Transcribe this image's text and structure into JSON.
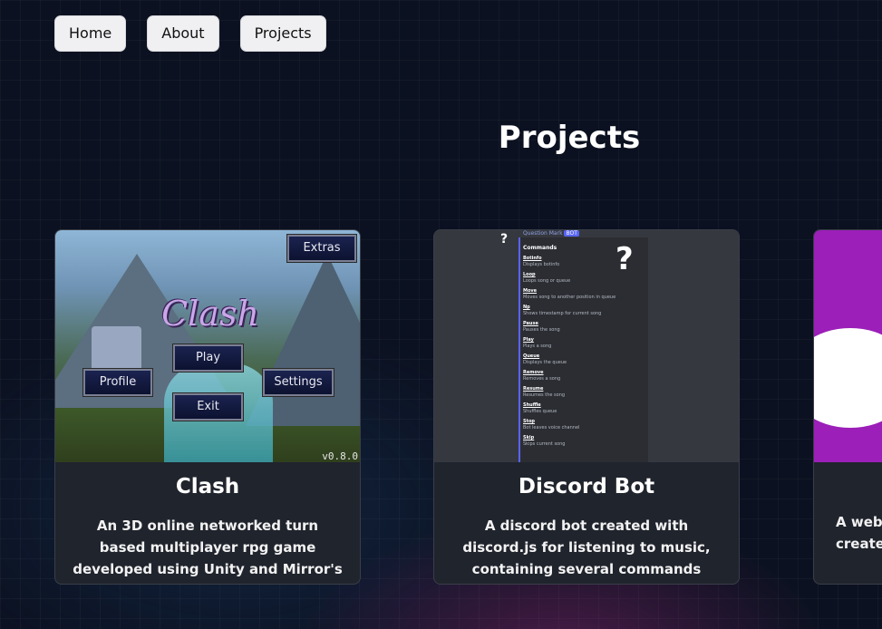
{
  "nav": {
    "items": [
      {
        "label": "Home"
      },
      {
        "label": "About"
      },
      {
        "label": "Projects"
      }
    ]
  },
  "page": {
    "title": "Projects"
  },
  "projects": [
    {
      "title": "Clash",
      "description": "An 3D online networked turn based multiplayer rpg game developed using Unity and Mirror's networking library",
      "image": {
        "logo": "Clash",
        "buttons": [
          "Extras",
          "Play",
          "Profile",
          "Settings",
          "Exit"
        ],
        "version": "v0.8.0"
      }
    },
    {
      "title": "Discord Bot",
      "description": "A discord bot created with discord.js for listening to music, containing several commands",
      "image": {
        "small_mark": "?",
        "big_mark": "?",
        "header": "Question Mark",
        "badge": "BOT",
        "commands_heading": "Commands",
        "commands": [
          {
            "name": "Botinfo",
            "desc": "Displays botinfo"
          },
          {
            "name": "Loop",
            "desc": "Loops song or queue"
          },
          {
            "name": "Move",
            "desc": "Moves song to another position in queue"
          },
          {
            "name": "Np",
            "desc": "Shows timestamp for current song"
          },
          {
            "name": "Pause",
            "desc": "Pauses the song"
          },
          {
            "name": "Play",
            "desc": "Plays a song"
          },
          {
            "name": "Queue",
            "desc": "Displays the queue"
          },
          {
            "name": "Remove",
            "desc": "Removes a song"
          },
          {
            "name": "Resume",
            "desc": "Resumes the song"
          },
          {
            "name": "Shuffle",
            "desc": "Shuffles queue"
          },
          {
            "name": "Stop",
            "desc": "Bot leaves voice channel"
          },
          {
            "name": "Skip",
            "desc": "Skips current song"
          }
        ]
      }
    },
    {
      "title_partial": "",
      "description_partial": "A webs\ncreated w"
    }
  ],
  "colors": {
    "background": "#0b1120",
    "card": "#20242d",
    "nav_button": "#f0f0f2",
    "discord_accent": "#5865f2",
    "third_card_accent": "#9b1fb8"
  }
}
